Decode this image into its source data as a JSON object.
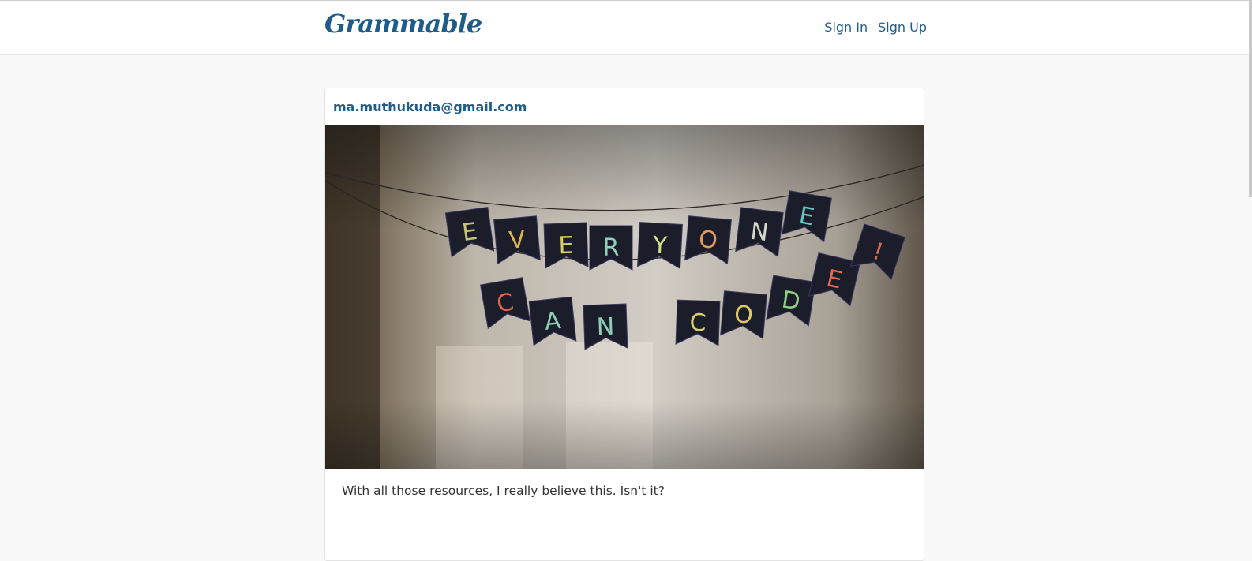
{
  "navbar": {
    "brand": "Grammable",
    "links": [
      {
        "label": "Sign In"
      },
      {
        "label": "Sign Up"
      }
    ],
    "link_color": "#1f5c8a"
  },
  "post": {
    "author": "ma.muthukuda@gmail.com",
    "caption": "With all those resources, I really believe this. Isn't it?",
    "photo": {
      "banner_top": [
        "E",
        "V",
        "E",
        "R",
        "Y",
        "O",
        "N",
        "E"
      ],
      "banner_bottom": [
        "C",
        "A",
        "N",
        "C",
        "O",
        "D",
        "E",
        "!"
      ]
    }
  }
}
